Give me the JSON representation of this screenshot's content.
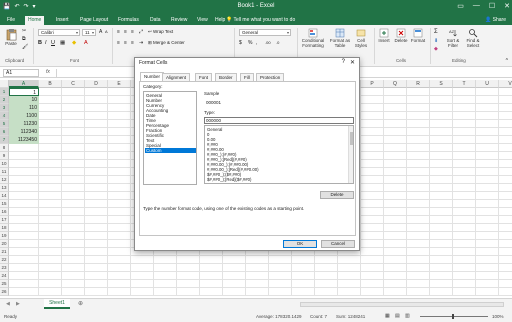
{
  "window": {
    "title": "Book1 - Excel",
    "controls": [
      "▭",
      "—",
      "☐",
      "✕"
    ]
  },
  "qat": [
    "💾",
    "↶",
    "↷",
    "▾"
  ],
  "ribbon_tabs": [
    "File",
    "Home",
    "Insert",
    "Page Layout",
    "Formulas",
    "Data",
    "Review",
    "View",
    "Help"
  ],
  "tell_me": "Tell me what you want to do",
  "share": "Share",
  "ribbon": {
    "paste": "Paste",
    "font_name": "Calibri",
    "font_size": "11",
    "wrap_text": "Wrap Text",
    "merge_center": "Merge & Center",
    "number_format": "General",
    "conditional_formatting": "Conditional Formatting",
    "format_as_table": "Format as Table",
    "cell_styles": "Cell Styles",
    "insert": "Insert",
    "delete": "Delete",
    "format": "Format",
    "autosum": "Σ",
    "sort_filter": "Sort & Filter",
    "find_select": "Find & Select",
    "groups": [
      "Clipboard",
      "Font",
      "Alignment",
      "Number",
      "Styles",
      "Cells",
      "Editing"
    ]
  },
  "formula_bar": {
    "name_box": "A1",
    "fx": "fx"
  },
  "grid": {
    "columns": [
      "A",
      "B",
      "C",
      "D",
      "E",
      "F",
      "G",
      "H",
      "I",
      "J",
      "K",
      "L",
      "M",
      "N",
      "O",
      "P",
      "Q",
      "R",
      "S",
      "T",
      "U",
      "V",
      "W",
      "X",
      "Y"
    ],
    "rows": [
      "1",
      "2",
      "3",
      "4",
      "5",
      "6",
      "7",
      "8",
      "9",
      "10",
      "11",
      "12",
      "13",
      "14",
      "15",
      "16",
      "17",
      "18",
      "19",
      "20",
      "21",
      "22",
      "23",
      "24",
      "25",
      "26"
    ],
    "cells_a": [
      "1",
      "10",
      "110",
      "1100",
      "11230",
      "112340",
      "1123450"
    ]
  },
  "sheet_tab": "Sheet1",
  "status": {
    "ready": "Ready",
    "average": "Average: 178320.1429",
    "count": "Count: 7",
    "sum": "Sum: 1248241",
    "zoom": "100%"
  },
  "dialog": {
    "title": "Format Cells",
    "help": "?",
    "close": "✕",
    "tabs": [
      "Number",
      "Alignment",
      "Font",
      "Border",
      "Fill",
      "Protection"
    ],
    "category_label": "Category:",
    "categories": [
      "General",
      "Number",
      "Currency",
      "Accounting",
      "Date",
      "Time",
      "Percentage",
      "Fraction",
      "Scientific",
      "Text",
      "Special",
      "Custom"
    ],
    "selected_category": "Custom",
    "sample_label": "Sample",
    "sample_value": "000001",
    "type_label": "Type:",
    "type_value": "000000",
    "format_codes": [
      "General",
      "0",
      "0.00",
      "#,##0",
      "#,##0.00",
      "#,##0_);(#,##0)",
      "#,##0_);[Red](#,##0)",
      "#,##0.00_);(#,##0.00)",
      "#,##0.00_);[Red](#,##0.00)",
      "$#,##0_);($#,##0)",
      "$#,##0_);[Red]($#,##0)"
    ],
    "delete_button": "Delete",
    "hint": "Type the number format code, using one of the existing codes as a starting point.",
    "ok_button": "OK",
    "cancel_button": "Cancel"
  },
  "colors": {
    "excel_green": "#217346",
    "selection_fill": "#c6dfc6",
    "list_highlight": "#0078d7"
  }
}
